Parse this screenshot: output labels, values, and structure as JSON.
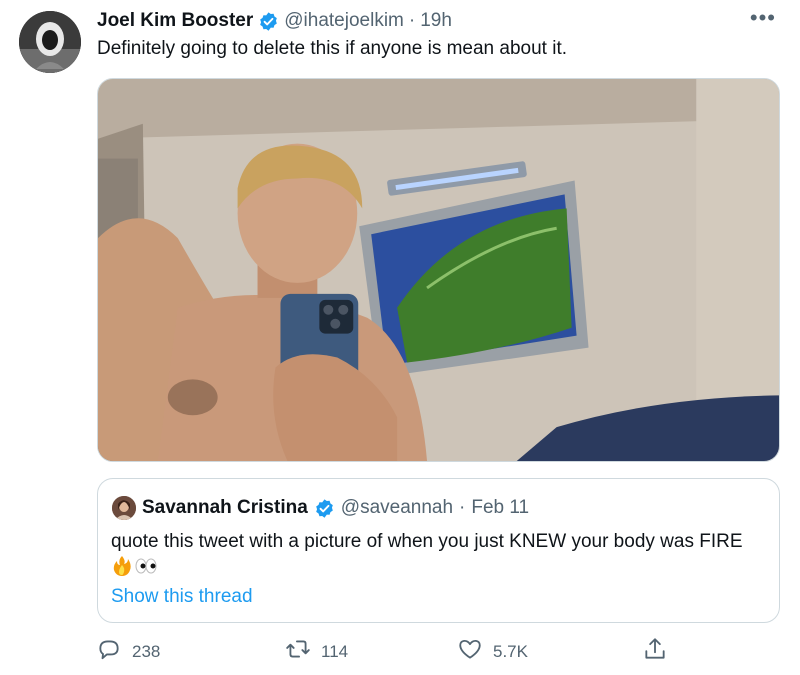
{
  "tweet": {
    "author_name": "Joel Kim Booster",
    "handle": "@ihatejoelkim",
    "separator": "·",
    "time": "19h",
    "text": "Definitely going to delete this if anyone is mean about it.",
    "more_icon": "more-horizontal-icon"
  },
  "quoted": {
    "author_name": "Savannah Cristina",
    "handle": "@saveannah",
    "separator": "·",
    "date": "Feb 11",
    "text": "quote this tweet with a picture of when you just KNEW your body was FIRE",
    "link": "Show this thread"
  },
  "actions": {
    "reply_count": "238",
    "retweet_count": "114",
    "like_count": "5.7K"
  },
  "colors": {
    "accent": "#1d9bf0",
    "secondary_text": "#536471",
    "border": "#cfd9de"
  }
}
